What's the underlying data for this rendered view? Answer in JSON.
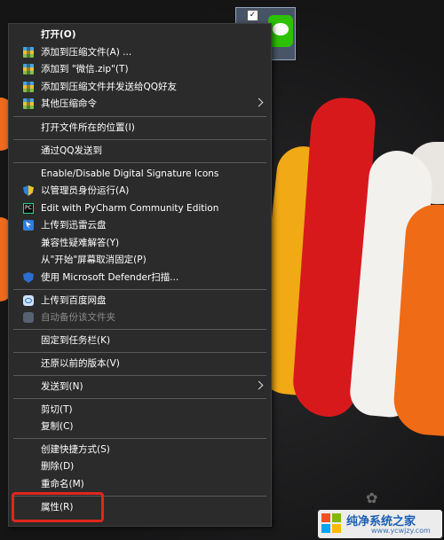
{
  "desktop": {
    "icon": {
      "name": "wechat-app-icon",
      "checked": true
    },
    "watermark": {
      "title": "纯净系统之家",
      "subtitle": "www.ycwjzy.com"
    }
  },
  "menu": {
    "items": [
      {
        "label": "打开(O)",
        "bold": true
      },
      {
        "label": "添加到压缩文件(A) ...",
        "icon": "winrar-icon"
      },
      {
        "label": "添加到 \"微信.zip\"(T)",
        "icon": "winrar-icon"
      },
      {
        "label": "添加到压缩文件并发送给QQ好友",
        "icon": "winrar-icon"
      },
      {
        "label": "其他压缩命令",
        "icon": "winrar-icon",
        "submenu": true
      },
      {
        "label": "打开文件所在的位置(I)"
      },
      {
        "label": "通过QQ发送到"
      },
      {
        "label": "Enable/Disable Digital Signature Icons"
      },
      {
        "label": "以管理员身份运行(A)",
        "icon": "uac-shield-icon"
      },
      {
        "label": "Edit with PyCharm Community Edition",
        "icon": "pycharm-icon"
      },
      {
        "label": "上传到迅雷云盘",
        "icon": "thunder-icon"
      },
      {
        "label": "兼容性疑难解答(Y)"
      },
      {
        "label": "从\"开始\"屏幕取消固定(P)"
      },
      {
        "label": "使用 Microsoft Defender扫描...",
        "icon": "defender-icon"
      },
      {
        "label": "上传到百度网盘",
        "icon": "baidu-netdisk-icon"
      },
      {
        "label": "自动备份该文件夹",
        "icon": "baidu-netdisk-icon",
        "disabled": true
      },
      {
        "label": "固定到任务栏(K)"
      },
      {
        "label": "还原以前的版本(V)"
      },
      {
        "label": "发送到(N)",
        "submenu": true
      },
      {
        "label": "剪切(T)"
      },
      {
        "label": "复制(C)"
      },
      {
        "label": "创建快捷方式(S)"
      },
      {
        "label": "删除(D)"
      },
      {
        "label": "重命名(M)"
      },
      {
        "label": "属性(R)",
        "highlighted": true
      }
    ]
  },
  "colors": {
    "menu_bg": "#2b2b2b",
    "menu_text": "#ffffff",
    "highlight_border": "#e1251b"
  }
}
